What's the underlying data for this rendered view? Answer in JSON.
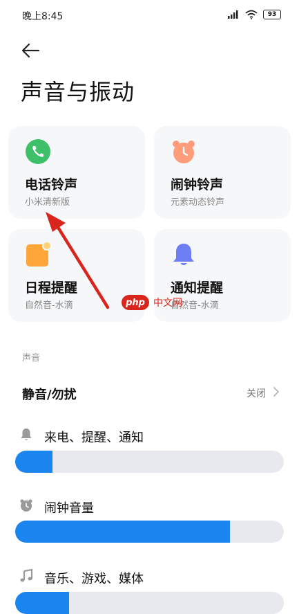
{
  "status_bar": {
    "time": "晚上8:45",
    "battery": "93"
  },
  "page": {
    "title": "声音与振动"
  },
  "tiles": [
    {
      "id": "phone",
      "title": "电话铃声",
      "subtitle": "小米清新版",
      "icon": "phone-icon",
      "color": "#3ec06a"
    },
    {
      "id": "alarm",
      "title": "闹钟铃声",
      "subtitle": "元素动态铃声",
      "icon": "alarm-clock-icon",
      "color": "#ff9d7a"
    },
    {
      "id": "calendar",
      "title": "日程提醒",
      "subtitle": "自然音-水滴",
      "icon": "calendar-icon",
      "color": "#ffa63a"
    },
    {
      "id": "notify",
      "title": "通知提醒",
      "subtitle": "自然音-水滴",
      "icon": "bell-icon",
      "color": "#6e7ff3"
    }
  ],
  "section": {
    "label": "声音"
  },
  "mute": {
    "label": "静音/勿扰",
    "value": "关闭"
  },
  "volumes": [
    {
      "id": "ring",
      "label": "来电、提醒、通知",
      "icon": "bell-icon",
      "level": 0.14
    },
    {
      "id": "alarm",
      "label": "闹钟音量",
      "icon": "alarm-clock-icon",
      "level": 0.8
    },
    {
      "id": "media",
      "label": "音乐、游戏、媒体",
      "icon": "music-note-icon",
      "level": 0.2
    }
  ],
  "watermark": {
    "badge": "php",
    "text": "中文网"
  },
  "colors": {
    "accent": "#1a85ee",
    "annotation_arrow": "#d9261c"
  }
}
